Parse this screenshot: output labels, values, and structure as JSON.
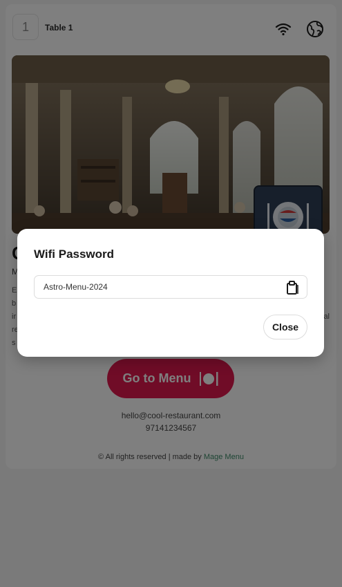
{
  "header": {
    "table_number": "1",
    "table_label": "Table 1"
  },
  "restaurant": {
    "title_partial": "C",
    "subtitle_partial": "M",
    "description_lines": [
      "E",
      "b",
      "ir",
      "re",
      "s"
    ],
    "description_right": "al"
  },
  "actions": {
    "go_to_menu_label": "Go to Menu"
  },
  "contact": {
    "email": "hello@cool-restaurant.com",
    "phone": "97141234567"
  },
  "footer": {
    "rights": "© All rights reserved | made by ",
    "brand": "Mage Menu"
  },
  "wifi_modal": {
    "title": "Wifi Password",
    "password": "Astro-Menu-2024",
    "close_label": "Close"
  },
  "colors": {
    "accent": "#e0194f",
    "brand_link": "#3d8b69"
  },
  "icons": [
    "wifi-icon",
    "globe-icon",
    "copy-icon",
    "cutlery-icon"
  ]
}
